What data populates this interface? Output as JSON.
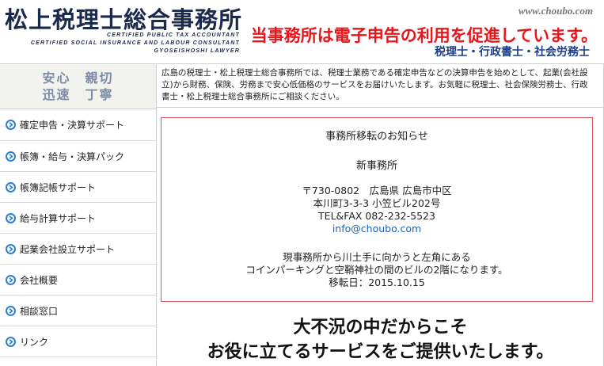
{
  "header": {
    "title": "松上税理士総合事務所",
    "english_lines": [
      "Certified Public Tax Accountant",
      "Certified Social Insurance and Labour Consultant",
      "Gyoseishoshi Lawyer"
    ],
    "url": "www.choubo.com",
    "promo": "当事務所は電子申告の利用を促進しています。",
    "qualifications": "税理士・行政書士・社会労務士"
  },
  "motto": {
    "line1": "安心　親切",
    "line2": "迅速　丁寧"
  },
  "intro": "広島の税理士・松上税理士総合事務所では、税理士業務である確定申告などの決算申告を始めとして、起業(会社設立)から財務、保険、労務まで安心低価格のサービスをお届けいたします。お気軽に税理士、社会保険労務士、行政書士・松上税理士総合事務所にご相談ください。",
  "nav": {
    "items": [
      {
        "label": "確定申告・決算サポート"
      },
      {
        "label": "帳簿・給与・決算パック"
      },
      {
        "label": "帳簿記帳サポート"
      },
      {
        "label": "給与計算サポート"
      },
      {
        "label": "起業会社設立サポート"
      },
      {
        "label": "会社概要"
      },
      {
        "label": "相談窓口"
      },
      {
        "label": "リンク"
      }
    ]
  },
  "notice": {
    "title": "事務所移転のお知らせ",
    "subtitle": "新事務所",
    "address_line1": "〒730-0802　広島県 広島市中区",
    "address_line2": "本川町3-3-3 小笠ビル202号",
    "tel_fax": "TEL&FAX 082-232-5523",
    "email": "info@choubo.com",
    "desc_line1": "現事務所から川土手に向かうと左角にある",
    "desc_line2": "コインパーキングと空鞘神社の間のビルの2階になります。",
    "date": "移転日：2015.10.15"
  },
  "catch": {
    "line1": "大不況の中だからこそ",
    "line2": "お役に立てるサービスをご提供いたします。"
  },
  "colors": {
    "promo": "#e8151b",
    "qualifications": "#1b3d8c",
    "nav_bullet": "#2a7fd0",
    "notice_border": "#d4545a",
    "email_link": "#1c62b9"
  },
  "icons": {
    "nav_bullet": "chevron-right-circle-icon"
  }
}
